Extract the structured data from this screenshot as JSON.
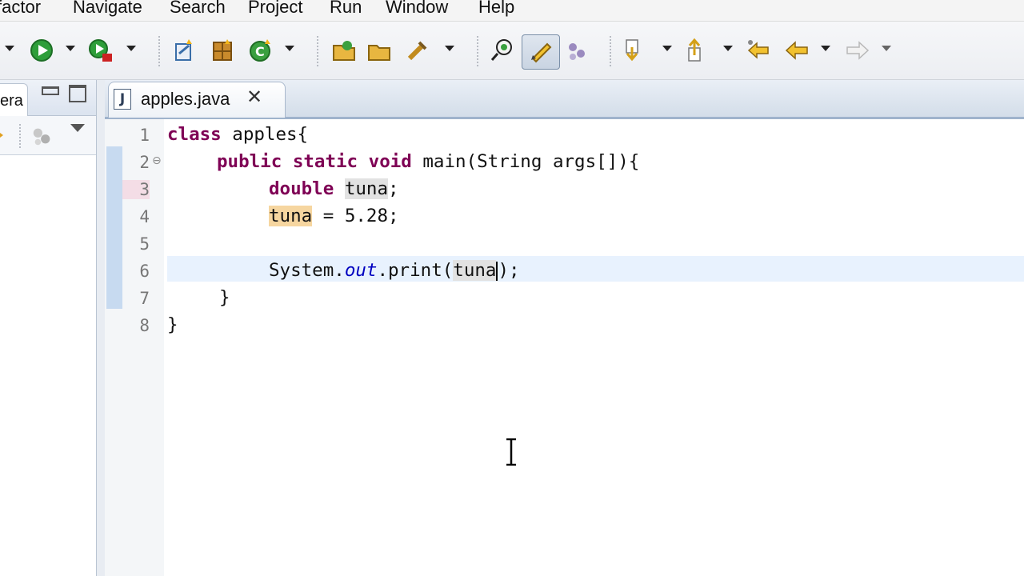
{
  "menubar": {
    "items": [
      "factor",
      "Navigate",
      "Search",
      "Project",
      "Run",
      "Window",
      "Help"
    ]
  },
  "left_panel": {
    "tab_label": "era"
  },
  "editor": {
    "tab": {
      "title": "apples.java",
      "icon": "java-file-icon",
      "close_glyph": "✕"
    },
    "line_numbers": [
      "1",
      "2",
      "3",
      "4",
      "5",
      "6",
      "7",
      "8"
    ],
    "code": {
      "l1_kw": "class",
      "l1_rest": " apples{",
      "l2_kw": "public static void",
      "l2_rest": " main(String args[]){",
      "l3_kw": "double",
      "l3_var": "tuna",
      "l3_rest": ";",
      "l4_var": "tuna",
      "l4_rest": " = 5.28;",
      "l6_a": "System.",
      "l6_field": "out",
      "l6_b": ".print(",
      "l6_var": "tuna",
      "l6_c": ");",
      "l7": "}",
      "l8": "}"
    }
  },
  "colors": {
    "keyword": "#7f0055",
    "field": "#0000c0",
    "occurrence_highlight": "#e2e2e2",
    "write_highlight": "#f6d6a0",
    "current_line": "#e8f2fe"
  }
}
